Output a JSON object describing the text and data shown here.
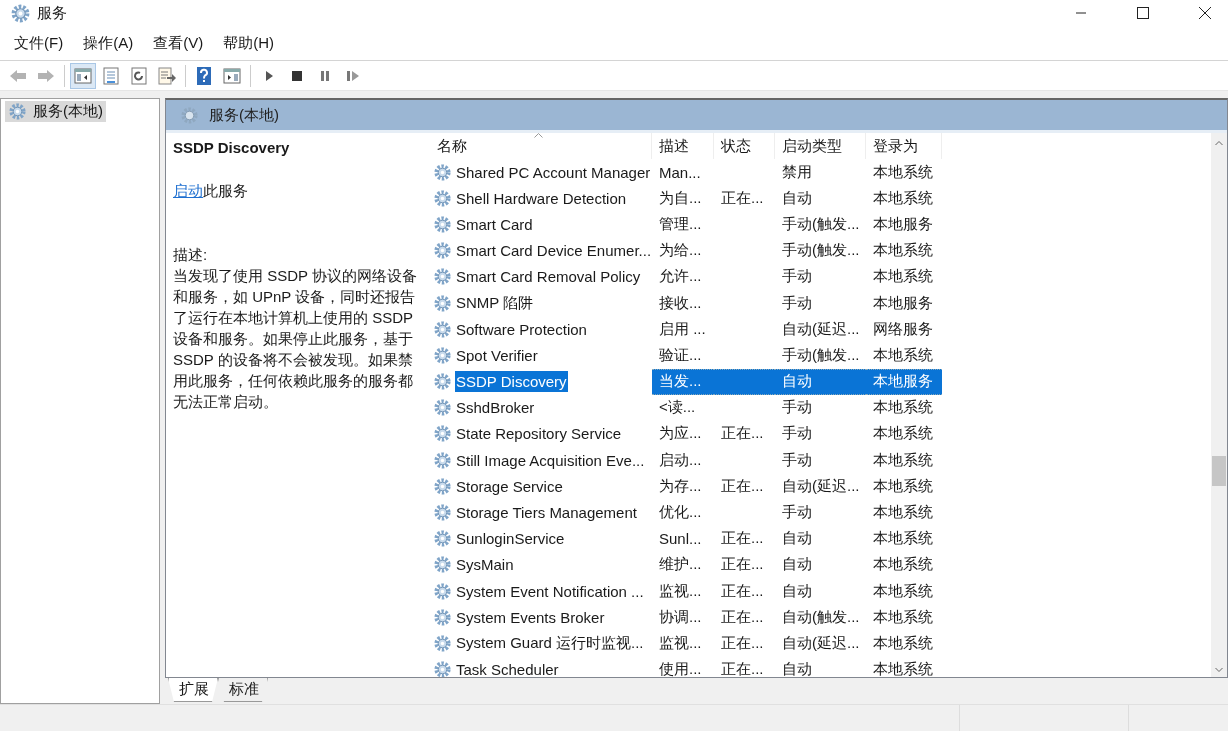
{
  "window": {
    "title": "服务"
  },
  "menu": [
    "文件(F)",
    "操作(A)",
    "查看(V)",
    "帮助(H)"
  ],
  "toolbar": [
    {
      "kind": "back",
      "selected": false,
      "disabled": true
    },
    {
      "kind": "forward",
      "selected": false,
      "disabled": true
    },
    {
      "kind": "tree",
      "selected": true,
      "disabled": false
    },
    {
      "kind": "properties",
      "selected": false,
      "disabled": false
    },
    {
      "kind": "refresh",
      "selected": false,
      "disabled": false
    },
    {
      "kind": "export",
      "selected": false,
      "disabled": false
    },
    {
      "kind": "help",
      "selected": false,
      "disabled": false
    },
    {
      "kind": "pane",
      "selected": false,
      "disabled": false
    },
    {
      "kind": "play",
      "selected": false,
      "disabled": false
    },
    {
      "kind": "stop",
      "selected": false,
      "disabled": false
    },
    {
      "kind": "pause",
      "selected": false,
      "disabled": false
    },
    {
      "kind": "restart",
      "selected": false,
      "disabled": false
    }
  ],
  "tree": {
    "items": [
      {
        "label": "服务(本地)",
        "selected": true
      }
    ]
  },
  "pane": {
    "title": "服务(本地)"
  },
  "details": {
    "name": "SSDP Discovery",
    "action_link": "启动",
    "action_text": "此服务",
    "description_label": "描述:",
    "description": "当发现了使用 SSDP 协议的网络设备和服务，如 UPnP 设备，同时还报告了运行在本地计算机上使用的 SSDP 设备和服务。如果停止此服务，基于 SSDP 的设备将不会被发现。如果禁用此服务，任何依赖此服务的服务都无法正常启动。"
  },
  "table": {
    "columns": [
      {
        "label": "名称",
        "sorted": true
      },
      {
        "label": "描述",
        "sorted": false
      },
      {
        "label": "状态",
        "sorted": false
      },
      {
        "label": "启动类型",
        "sorted": false
      },
      {
        "label": "登录为",
        "sorted": false
      }
    ],
    "rows": [
      {
        "name": "Shared PC Account Manager",
        "description": "Man...",
        "status": "",
        "startup": "禁用",
        "logon": "本地系统",
        "selected": false
      },
      {
        "name": "Shell Hardware Detection",
        "description": "为自...",
        "status": "正在...",
        "startup": "自动",
        "logon": "本地系统",
        "selected": false
      },
      {
        "name": "Smart Card",
        "description": "管理...",
        "status": "",
        "startup": "手动(触发...",
        "logon": "本地服务",
        "selected": false
      },
      {
        "name": "Smart Card Device Enumer...",
        "description": "为给...",
        "status": "",
        "startup": "手动(触发...",
        "logon": "本地系统",
        "selected": false
      },
      {
        "name": "Smart Card Removal Policy",
        "description": "允许...",
        "status": "",
        "startup": "手动",
        "logon": "本地系统",
        "selected": false
      },
      {
        "name": "SNMP 陷阱",
        "description": "接收...",
        "status": "",
        "startup": "手动",
        "logon": "本地服务",
        "selected": false
      },
      {
        "name": "Software Protection",
        "description": "启用 ...",
        "status": "",
        "startup": "自动(延迟...",
        "logon": "网络服务",
        "selected": false
      },
      {
        "name": "Spot Verifier",
        "description": "验证...",
        "status": "",
        "startup": "手动(触发...",
        "logon": "本地系统",
        "selected": false
      },
      {
        "name": "SSDP Discovery",
        "description": "当发...",
        "status": "",
        "startup": "自动",
        "logon": "本地服务",
        "selected": true
      },
      {
        "name": "SshdBroker",
        "description": "<读...",
        "status": "",
        "startup": "手动",
        "logon": "本地系统",
        "selected": false
      },
      {
        "name": "State Repository Service",
        "description": "为应...",
        "status": "正在...",
        "startup": "手动",
        "logon": "本地系统",
        "selected": false
      },
      {
        "name": "Still Image Acquisition Eve...",
        "description": "启动...",
        "status": "",
        "startup": "手动",
        "logon": "本地系统",
        "selected": false
      },
      {
        "name": "Storage Service",
        "description": "为存...",
        "status": "正在...",
        "startup": "自动(延迟...",
        "logon": "本地系统",
        "selected": false
      },
      {
        "name": "Storage Tiers Management",
        "description": "优化...",
        "status": "",
        "startup": "手动",
        "logon": "本地系统",
        "selected": false
      },
      {
        "name": "SunloginService",
        "description": "Sunl...",
        "status": "正在...",
        "startup": "自动",
        "logon": "本地系统",
        "selected": false
      },
      {
        "name": "SysMain",
        "description": "维护...",
        "status": "正在...",
        "startup": "自动",
        "logon": "本地系统",
        "selected": false
      },
      {
        "name": "System Event Notification ...",
        "description": "监视...",
        "status": "正在...",
        "startup": "自动",
        "logon": "本地系统",
        "selected": false
      },
      {
        "name": "System Events Broker",
        "description": "协调...",
        "status": "正在...",
        "startup": "自动(触发...",
        "logon": "本地系统",
        "selected": false
      },
      {
        "name": "System Guard 运行时监视...",
        "description": "监视...",
        "status": "正在...",
        "startup": "自动(延迟...",
        "logon": "本地系统",
        "selected": false
      },
      {
        "name": "Task Scheduler",
        "description": "使用...",
        "status": "正在...",
        "startup": "自动",
        "logon": "本地系统",
        "selected": false
      }
    ]
  },
  "tabs": [
    {
      "label": "扩展",
      "selected": true
    },
    {
      "label": "标准",
      "selected": false
    }
  ]
}
